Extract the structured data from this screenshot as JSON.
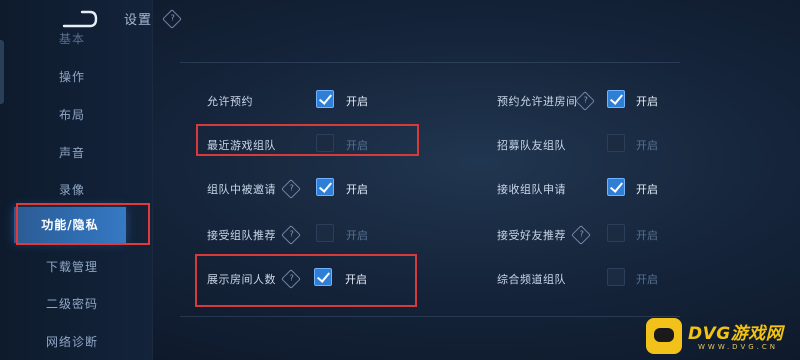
{
  "header": {
    "title": "设置",
    "help_glyph": "?"
  },
  "sidebar": {
    "items": [
      {
        "label": "基本",
        "state": "partial"
      },
      {
        "label": "操作",
        "state": "normal"
      },
      {
        "label": "布局",
        "state": "normal"
      },
      {
        "label": "声音",
        "state": "normal"
      },
      {
        "label": "录像",
        "state": "normal"
      },
      {
        "label": "功能/隐私",
        "state": "active"
      },
      {
        "label": "下载管理",
        "state": "normal"
      },
      {
        "label": "二级密码",
        "state": "normal"
      },
      {
        "label": "网络诊断",
        "state": "normal"
      }
    ]
  },
  "settings": {
    "on_label": "开启",
    "help_glyph": "?",
    "left": [
      {
        "label": "允许预约",
        "checked": true,
        "has_help": false
      },
      {
        "label": "最近游戏组队",
        "checked": false,
        "has_help": false
      },
      {
        "label": "组队中被邀请",
        "checked": true,
        "has_help": true
      },
      {
        "label": "接受组队推荐",
        "checked": false,
        "has_help": true
      },
      {
        "label": "展示房间人数",
        "checked": true,
        "has_help": true
      }
    ],
    "right": [
      {
        "label": "预约允许进房间",
        "checked": true,
        "has_help": true
      },
      {
        "label": "招募队友组队",
        "checked": false,
        "has_help": false
      },
      {
        "label": "接收组队申请",
        "checked": true,
        "has_help": false
      },
      {
        "label": "接受好友推荐",
        "checked": false,
        "has_help": true
      },
      {
        "label": "综合频道组队",
        "checked": false,
        "has_help": false
      }
    ]
  },
  "colors": {
    "checkbox_on": "#2f7fd6",
    "checkbox_off": "#1b2b42",
    "highlight_frame": "#d83a3a",
    "active_tab": "#2f6cb0"
  },
  "watermark": {
    "title": "DVG游戏网",
    "subtitle": "WWW.DVG.CN",
    "logo_icon": "gamepad-logo-icon"
  }
}
